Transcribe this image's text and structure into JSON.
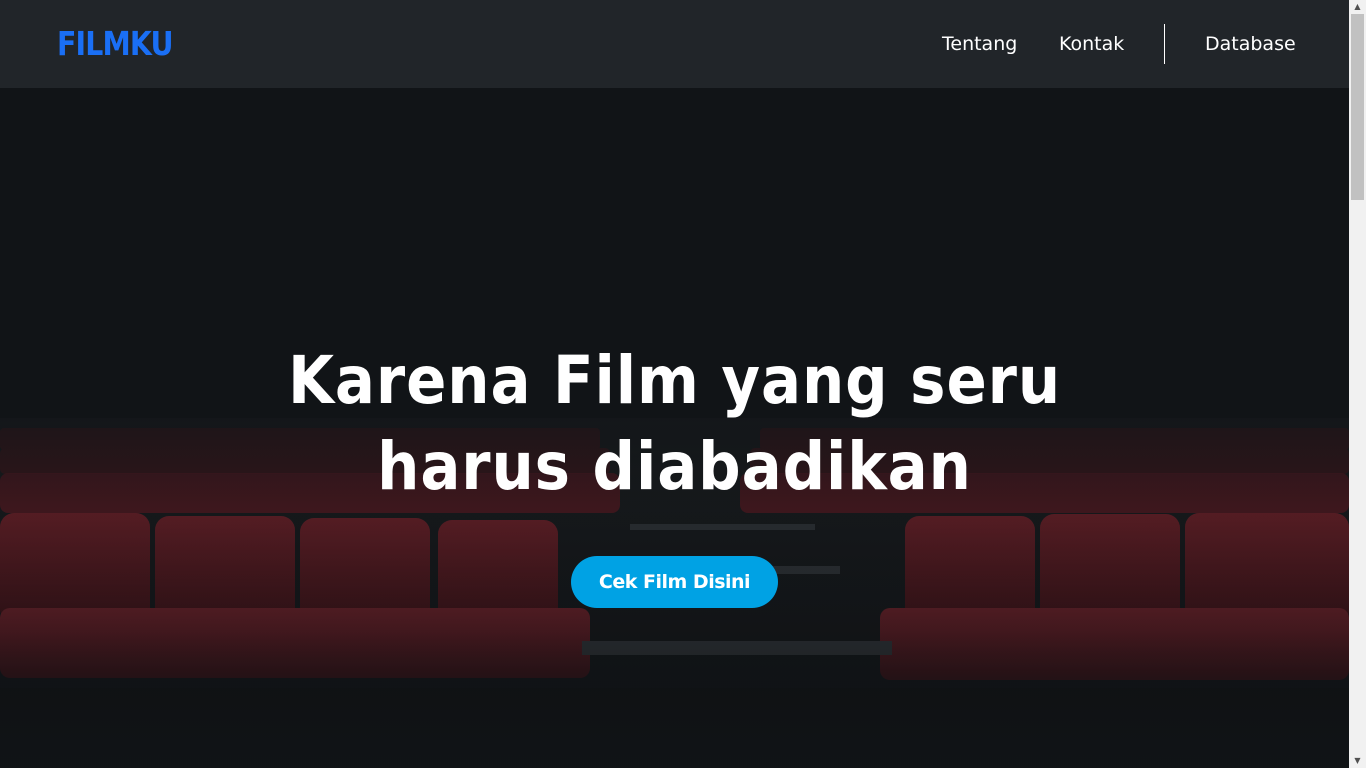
{
  "navbar": {
    "brand": "FILMKU",
    "links": [
      {
        "label": "Tentang"
      },
      {
        "label": "Kontak"
      },
      {
        "label": "Database"
      }
    ]
  },
  "hero": {
    "title": "Karena Film yang seru harus diabadikan",
    "cta_label": "Cek Film Disini",
    "background_image": "cinema-seats-photo"
  },
  "scrollbar": {
    "up_icon": "▲",
    "down_icon": "▼"
  },
  "colors": {
    "navbar_bg": "#212529",
    "brand": "#1a6ff5",
    "cta_bg": "#00a2e4",
    "hero_bg": "#111417",
    "seat": "#5a1a20"
  }
}
